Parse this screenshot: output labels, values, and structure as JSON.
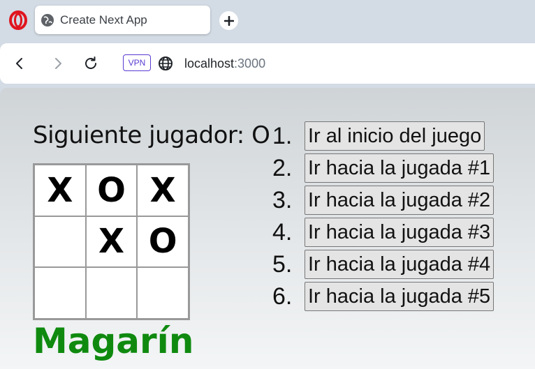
{
  "browser": {
    "tab_title": "Create Next App",
    "url_host": "localhost",
    "url_port": ":3000",
    "vpn_label": "VPN"
  },
  "game": {
    "status": "Siguiente jugador: O",
    "board": [
      "X",
      "O",
      "X",
      "",
      "X",
      "O",
      "",
      "",
      ""
    ],
    "moves": [
      {
        "num": "1.",
        "label": "Ir al inicio del juego"
      },
      {
        "num": "2.",
        "label": "Ir hacia la jugada #1"
      },
      {
        "num": "3.",
        "label": "Ir hacia la jugada #2"
      },
      {
        "num": "4.",
        "label": "Ir hacia la jugada #3"
      },
      {
        "num": "5.",
        "label": "Ir hacia la jugada #4"
      },
      {
        "num": "6.",
        "label": "Ir hacia la jugada #5"
      }
    ],
    "brand": "Magarín"
  },
  "colors": {
    "brand_green": "#0f8a0f",
    "vpn_purple": "#5b3ad1",
    "opera_red": "#e0141e"
  }
}
